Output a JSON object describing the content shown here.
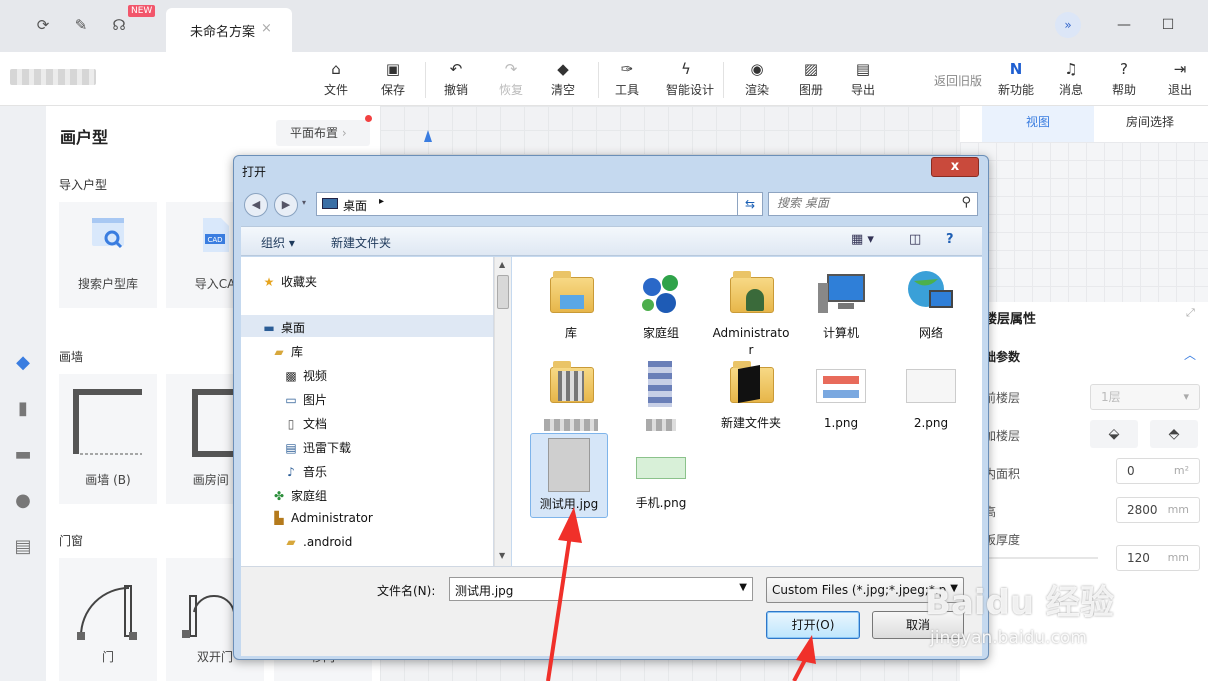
{
  "tabbar": {
    "new_badge": "NEW",
    "doc_tab": "未命名方案",
    "close": "×"
  },
  "toolbar": {
    "items": [
      {
        "label": "文件",
        "icon": "file-icon"
      },
      {
        "label": "保存",
        "icon": "save-icon"
      },
      {
        "label": "撤销",
        "icon": "undo-icon"
      },
      {
        "label": "恢复",
        "icon": "redo-icon"
      },
      {
        "label": "清空",
        "icon": "eraser-icon"
      },
      {
        "label": "工具",
        "icon": "wrench-icon"
      },
      {
        "label": "智能设计",
        "icon": "lightning-icon"
      },
      {
        "label": "渲染",
        "icon": "render-icon"
      },
      {
        "label": "图册",
        "icon": "album-icon"
      },
      {
        "label": "导出",
        "icon": "export-icon"
      },
      {
        "label": "新功能",
        "icon": "new-feature-icon"
      },
      {
        "label": "消息",
        "icon": "bell-icon"
      },
      {
        "label": "帮助",
        "icon": "help-icon"
      },
      {
        "label": "退出",
        "icon": "exit-icon"
      }
    ],
    "old_version": "返回旧版"
  },
  "left_panel": {
    "title": "画户型",
    "layout_button": "平面布置",
    "import_section": "导入户型",
    "import_cards": [
      "搜索户型库",
      "导入CA"
    ],
    "cad_tag": "CAD",
    "wall_section": "画墙",
    "wall_cards": [
      "画墙 (B)",
      "画房间 ("
    ],
    "door_section": "门窗",
    "door_cards": [
      "门",
      "双开门",
      "移门"
    ]
  },
  "right_panel": {
    "tabs": [
      "视图",
      "房间选择"
    ],
    "floor_props": "楼层属性",
    "basic_params": "础参数",
    "rows": [
      {
        "label": "前楼层",
        "value": "1层",
        "unit": "▾"
      },
      {
        "label": "加楼层"
      },
      {
        "label": "内面积",
        "value": "0",
        "unit": "m²"
      },
      {
        "label": "高",
        "value": "2800",
        "unit": "mm"
      },
      {
        "label": "板厚度",
        "value": "120",
        "unit": "mm"
      }
    ]
  },
  "dialog": {
    "title": "打开",
    "close": "x",
    "address": "桌面",
    "search_placeholder": "搜索 桌面",
    "organize": "组织 ▾",
    "new_folder": "新建文件夹",
    "nav": [
      {
        "label": "收藏夹",
        "icon": "star-icon"
      },
      {
        "label": "桌面",
        "icon": "desktop-icon"
      },
      {
        "label": "库",
        "icon": "library-icon"
      },
      {
        "label": "视频",
        "icon": "video-icon"
      },
      {
        "label": "图片",
        "icon": "picture-icon"
      },
      {
        "label": "文档",
        "icon": "document-icon"
      },
      {
        "label": "迅雷下载",
        "icon": "download-icon"
      },
      {
        "label": "音乐",
        "icon": "music-icon"
      },
      {
        "label": "家庭组",
        "icon": "homegroup-icon"
      },
      {
        "label": "Administrator",
        "icon": "user-folder-icon"
      },
      {
        "label": ".android",
        "icon": "folder-icon"
      }
    ],
    "files": [
      {
        "name": "库"
      },
      {
        "name": "家庭组"
      },
      {
        "name": "Administrator"
      },
      {
        "name": "计算机"
      },
      {
        "name": "网络"
      },
      {
        "name": ""
      },
      {
        "name": ""
      },
      {
        "name": "新建文件夹"
      },
      {
        "name": "1.png"
      },
      {
        "name": "2.png"
      },
      {
        "name": "测试用.jpg"
      },
      {
        "name": "手机.png"
      }
    ],
    "filename_label": "文件名(N):",
    "filename_value": "测试用.jpg",
    "filetype": "Custom Files (*.jpg;*.jpeg;*.p",
    "open_button": "打开(O)",
    "cancel_button": "取消"
  },
  "watermark": {
    "line1": "Baidu 经验",
    "line2": "jingyan.baidu.com"
  },
  "colors": {
    "accent": "#3a7de0",
    "arrow": "#f0302a"
  }
}
